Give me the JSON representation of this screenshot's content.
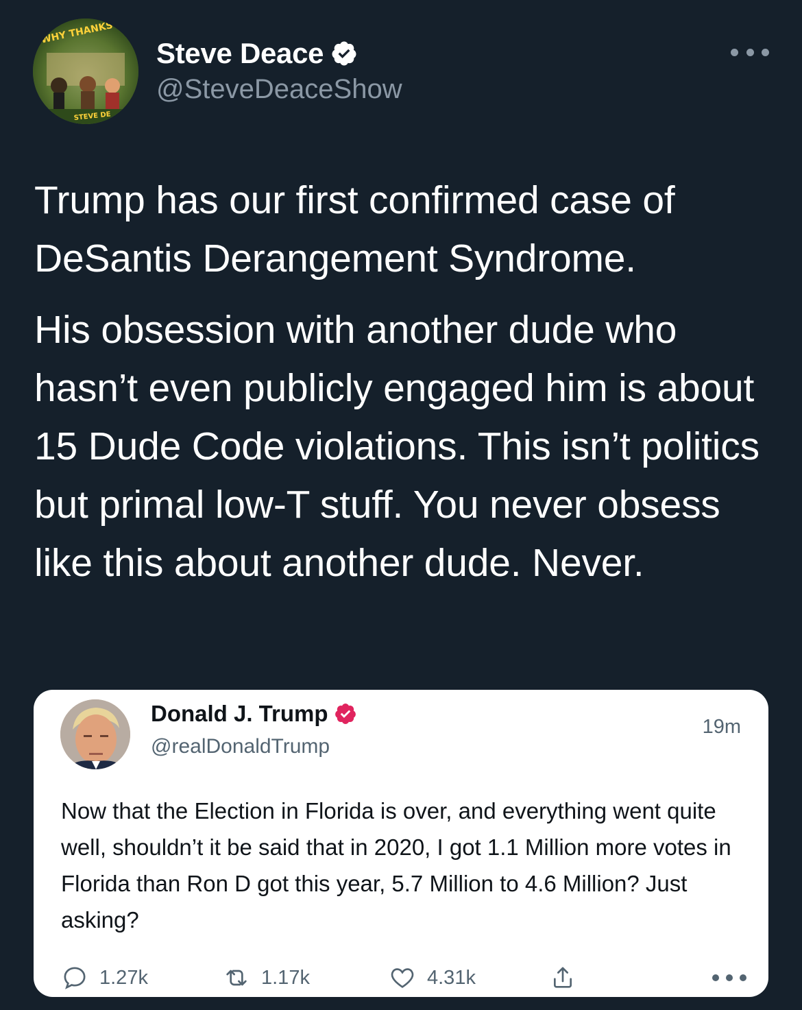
{
  "tweet": {
    "author": {
      "name": "Steve Deace",
      "handle": "@SteveDeaceShow",
      "avatar_text_top": "WHY THANKSGIVING",
      "avatar_text_bottom": "STEVE DE"
    },
    "verified_icon": "verified-badge-icon",
    "more_icon": "more-horizontal-icon",
    "paragraphs": [
      "Trump has our first confirmed case of DeSantis Derangement Syndrome.",
      "His obsession with another dude who hasn’t even publicly engaged him is about 15 Dude Code violations. This isn’t politics but primal low-T stuff. You never obsess like this about another dude. Never."
    ]
  },
  "quoted": {
    "author": {
      "name": "Donald J. Trump",
      "handle": "@realDonaldTrump"
    },
    "time": "19m",
    "text": "Now that the Election in Florida is over, and everything went quite well, shouldn’t it be said that in 2020, I got 1.1 Million more votes in Florida than Ron D got this year, 5.7 Million to 4.6 Million? Just asking?",
    "actions": {
      "replies": "1.27k",
      "retweets": "1.17k",
      "likes": "4.31k"
    }
  },
  "colors": {
    "background": "#15202b",
    "text_primary": "#ffffff",
    "text_secondary": "#8b98a5",
    "verified_blue": "#1d9bf0",
    "verified_red": "#e0245e",
    "card_background": "#ffffff"
  }
}
